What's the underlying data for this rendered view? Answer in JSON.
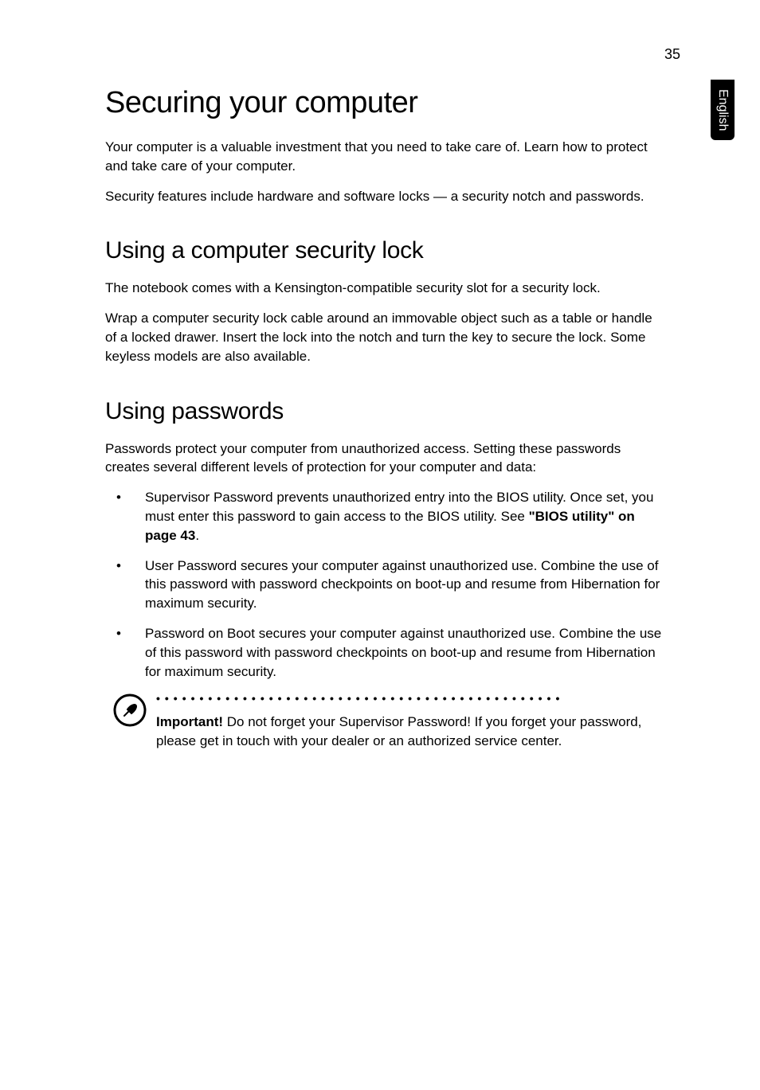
{
  "page_number": "35",
  "side_tab": "English",
  "title": "Securing your computer",
  "intro_para1": "Your computer is a valuable investment that you need to take care of. Learn how to protect and take care of your computer.",
  "intro_para2": "Security features include hardware and software locks — a security notch and passwords.",
  "section1": {
    "heading": "Using a computer security lock",
    "para1": "The notebook comes with a Kensington-compatible security slot for a security lock.",
    "para2": "Wrap a computer security lock cable around an immovable object such as a table or handle of a locked drawer. Insert the lock into the notch and turn the key to secure the lock. Some keyless models are also available."
  },
  "section2": {
    "heading": "Using passwords",
    "intro": "Passwords protect your computer from unauthorized access. Setting these passwords creates several different levels of protection for your computer and data:",
    "bullets": [
      {
        "text_before": "Supervisor Password prevents unauthorized entry into the BIOS utility. Once set, you must enter this password to gain access to the BIOS utility. See ",
        "bold_ref": "\"BIOS utility\" on page 43",
        "text_after": "."
      },
      {
        "text_before": "User Password secures your computer against unauthorized use. Combine the use of this password with password checkpoints on boot-up and resume from Hibernation for maximum security.",
        "bold_ref": "",
        "text_after": ""
      },
      {
        "text_before": "Password on Boot secures your computer against unauthorized use. Combine the use of this password with password checkpoints on boot-up and resume from Hibernation for maximum security.",
        "bold_ref": "",
        "text_after": ""
      }
    ],
    "note": {
      "bold_label": "Important!",
      "text": " Do not forget your Supervisor Password! If you forget your password, please get in touch with your dealer or an authorized service center."
    }
  }
}
